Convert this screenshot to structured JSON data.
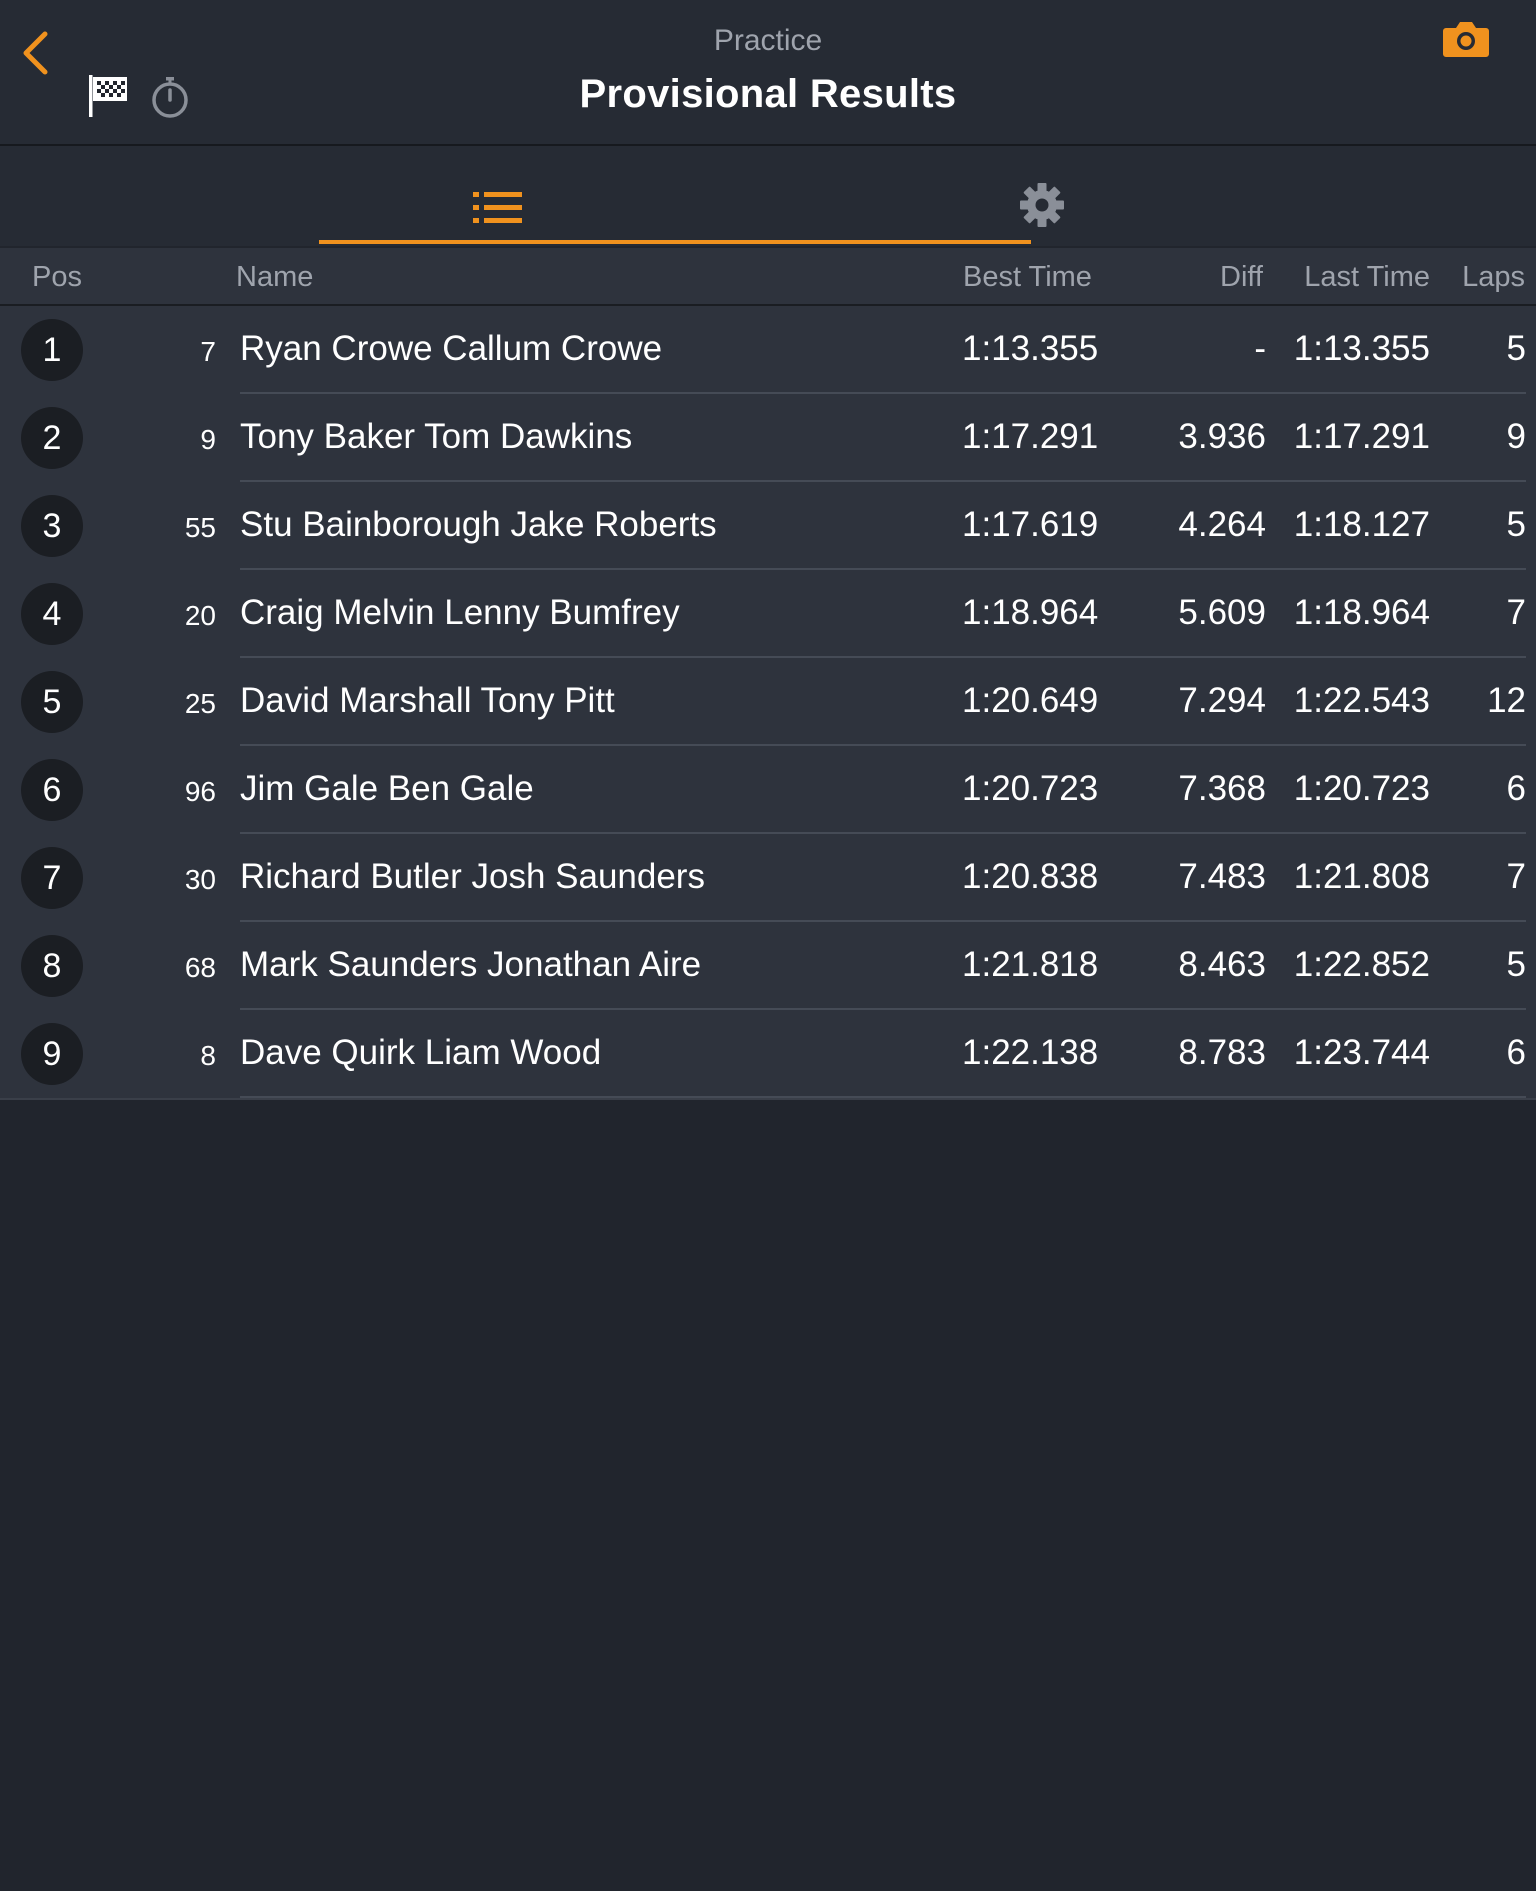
{
  "header": {
    "subtitle": "Practice",
    "title": "Provisional Results"
  },
  "colors": {
    "accent": "#f0921e",
    "background": "#21252d",
    "row_background": "#2e333d",
    "header_background": "#262b34"
  },
  "icons": {
    "back": "back-chevron-icon",
    "flag": "checkered-flag-icon",
    "stopwatch": "stopwatch-icon",
    "camera": "camera-icon",
    "list": "list-icon",
    "settings": "gear-icon"
  },
  "tabs": [
    {
      "name": "results",
      "icon": "list-icon",
      "active": true
    },
    {
      "name": "settings",
      "icon": "gear-icon",
      "active": false
    }
  ],
  "columns": {
    "pos": "Pos",
    "name": "Name",
    "best": "Best Time",
    "diff": "Diff",
    "last": "Last Time",
    "laps": "Laps"
  },
  "rows": [
    {
      "pos": "1",
      "car": "7",
      "name": "Ryan Crowe Callum Crowe",
      "best": "1:13.355",
      "diff": "-",
      "last": "1:13.355",
      "laps": "5"
    },
    {
      "pos": "2",
      "car": "9",
      "name": "Tony Baker Tom Dawkins",
      "best": "1:17.291",
      "diff": "3.936",
      "last": "1:17.291",
      "laps": "9"
    },
    {
      "pos": "3",
      "car": "55",
      "name": "Stu Bainborough Jake Roberts",
      "best": "1:17.619",
      "diff": "4.264",
      "last": "1:18.127",
      "laps": "5"
    },
    {
      "pos": "4",
      "car": "20",
      "name": "Craig Melvin Lenny Bumfrey",
      "best": "1:18.964",
      "diff": "5.609",
      "last": "1:18.964",
      "laps": "7"
    },
    {
      "pos": "5",
      "car": "25",
      "name": "David Marshall Tony Pitt",
      "best": "1:20.649",
      "diff": "7.294",
      "last": "1:22.543",
      "laps": "12"
    },
    {
      "pos": "6",
      "car": "96",
      "name": "Jim Gale Ben Gale",
      "best": "1:20.723",
      "diff": "7.368",
      "last": "1:20.723",
      "laps": "6"
    },
    {
      "pos": "7",
      "car": "30",
      "name": "Richard Butler Josh Saunders",
      "best": "1:20.838",
      "diff": "7.483",
      "last": "1:21.808",
      "laps": "7"
    },
    {
      "pos": "8",
      "car": "68",
      "name": "Mark Saunders Jonathan Aire",
      "best": "1:21.818",
      "diff": "8.463",
      "last": "1:22.852",
      "laps": "5"
    },
    {
      "pos": "9",
      "car": "8",
      "name": "Dave Quirk Liam Wood",
      "best": "1:22.138",
      "diff": "8.783",
      "last": "1:23.744",
      "laps": "6"
    }
  ]
}
